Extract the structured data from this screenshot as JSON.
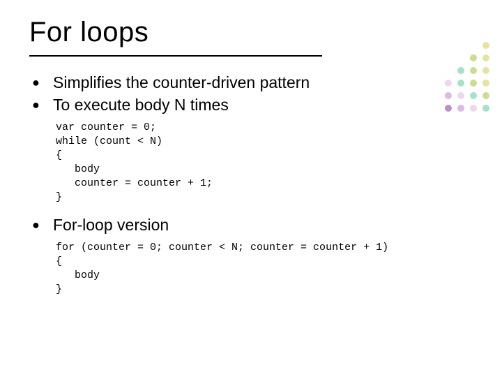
{
  "title": "For loops",
  "bullets": [
    {
      "text": "Simplifies the counter-driven pattern"
    },
    {
      "text": "To execute body N times"
    }
  ],
  "code1": "var counter = 0;\nwhile (count < N)\n{\n   body\n   counter = counter + 1;\n}",
  "bullet3": {
    "text": "For-loop version"
  },
  "code2": "for (counter = 0; counter < N; counter = counter + 1)\n{\n   body\n}",
  "decor": {
    "colors": [
      "#d9d97a",
      "#b7cf63",
      "#7fd6b0",
      "#d9d97a",
      "#b7cf63",
      "#7fd6b0",
      "#e6c6e6",
      "#d9d97a",
      "#b7cf63",
      "#7fd6b0",
      "#c9a0d6",
      "#e6c6e6",
      "#d9d97a",
      "#b7cf63",
      "#a060b0",
      "#c9a0d6",
      "#e6c6e6",
      "#d9d97a"
    ]
  }
}
